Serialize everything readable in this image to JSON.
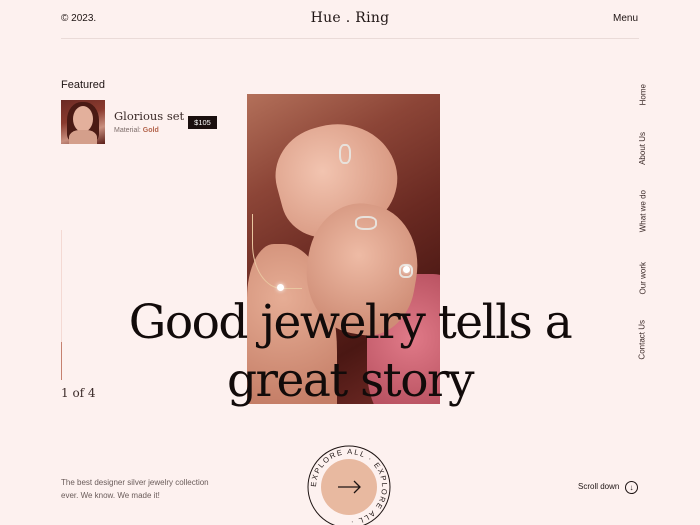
{
  "header": {
    "copyright": "© 2023.",
    "logo": "Hue . Ring",
    "menu_label": "Menu"
  },
  "featured": {
    "title": "Featured",
    "product_name": "Glorious set",
    "material_label": "Material:",
    "material_value": "Gold",
    "price": "$105"
  },
  "slider": {
    "counter": "1 of 4"
  },
  "hero": {
    "headline_line1": "Good jewelry tells a",
    "headline_line2": "great story"
  },
  "side_nav": {
    "items": [
      {
        "label": "Home"
      },
      {
        "label": "About Us"
      },
      {
        "label": "What we do"
      },
      {
        "label": "Our work"
      },
      {
        "label": "Contact Us"
      }
    ]
  },
  "footer": {
    "tagline": "The best designer silver jewelry collection ever. We know. We made it!",
    "explore_label": "EXPLORE ALL · EXPLORE ALL ·",
    "explore_icon": "arrow-right-icon",
    "scroll_label": "Scroll down",
    "scroll_icon": "arrow-down-circle-icon"
  },
  "colors": {
    "background": "#fdf1ef",
    "accent": "#e8b9a0",
    "dark": "#1a0f0e"
  }
}
